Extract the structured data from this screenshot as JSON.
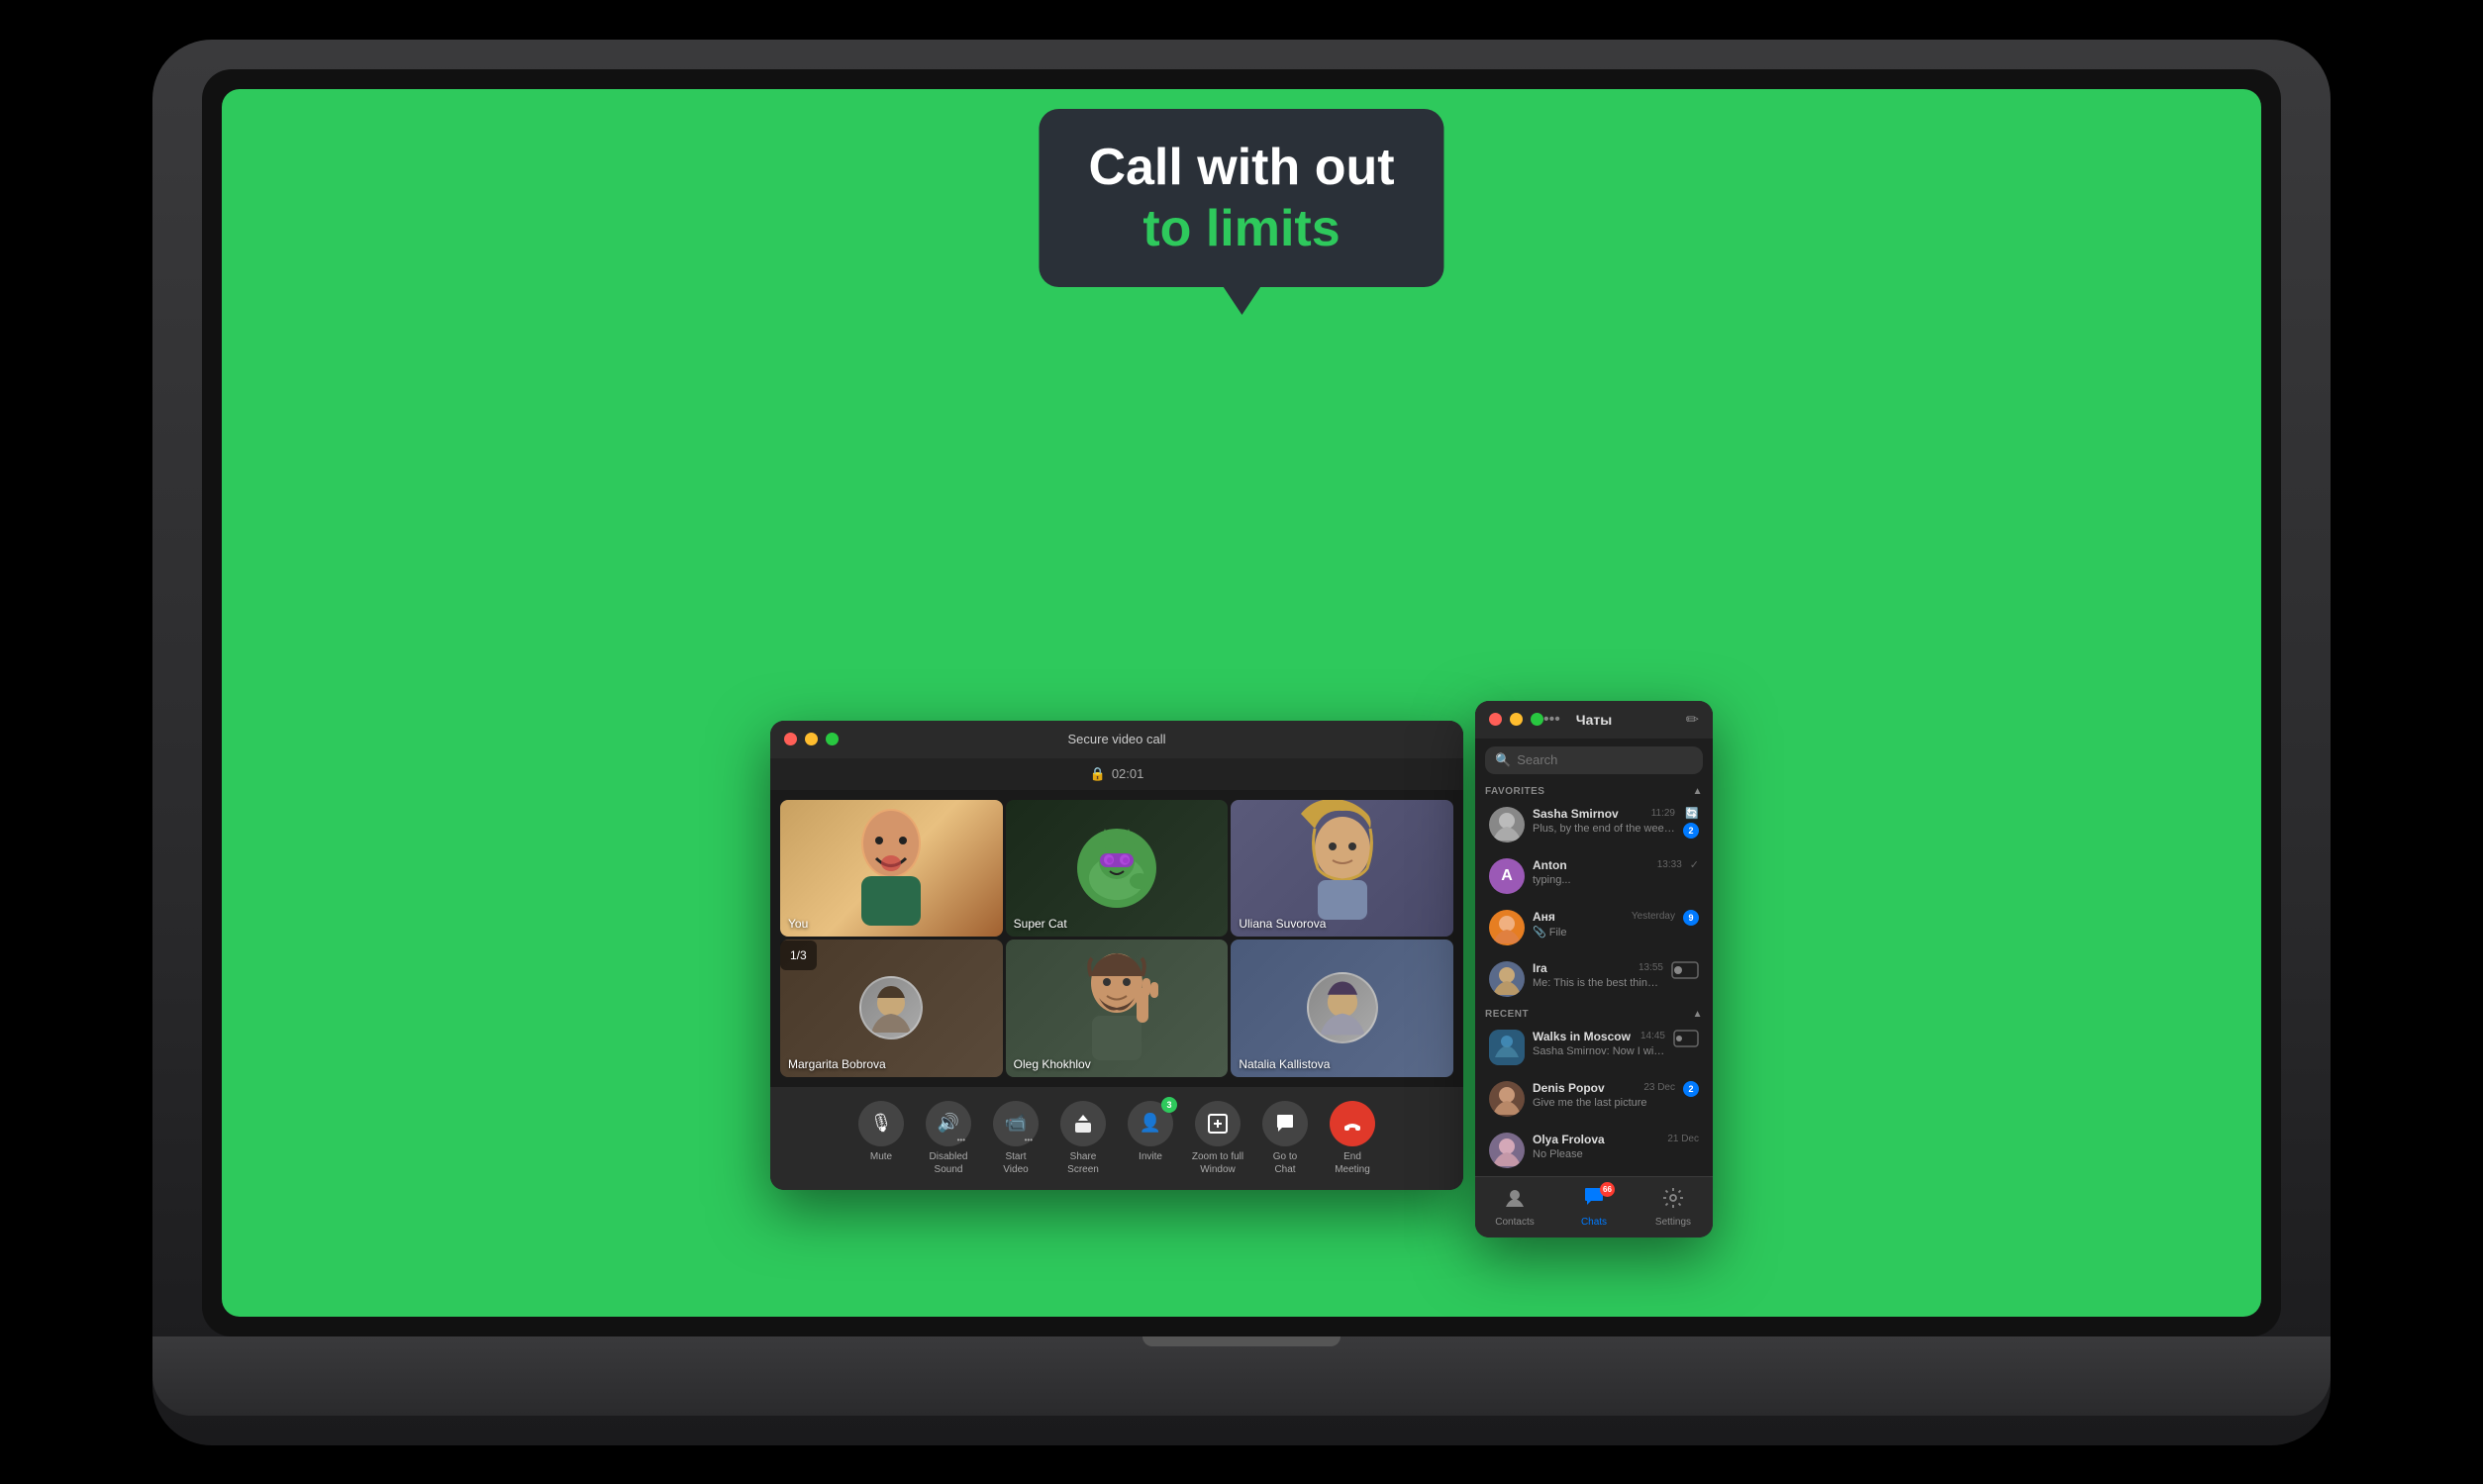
{
  "speechBubble": {
    "line1": "Call with out",
    "line2": "to limits"
  },
  "videoWindow": {
    "titlebarLabel": "Secure video call",
    "timer": "02:01",
    "participants": [
      {
        "id": "you",
        "label": "You",
        "type": "person"
      },
      {
        "id": "supercat",
        "label": "Super Cat",
        "type": "avatar"
      },
      {
        "id": "uliana",
        "label": "Uliana Suvorova",
        "type": "person"
      },
      {
        "id": "margarita",
        "label": "Margarita Bobrova",
        "type": "avatar"
      },
      {
        "id": "oleg",
        "label": "Oleg Khokhlov",
        "type": "person"
      },
      {
        "id": "natalia",
        "label": "Natalia Kallistova",
        "type": "avatar"
      }
    ],
    "pageIndicator": "1/3",
    "controls": [
      {
        "id": "mute",
        "icon": "🎙",
        "label": "Mute",
        "type": "normal"
      },
      {
        "id": "sound",
        "icon": "🔊",
        "label": "Disabled\nSound",
        "type": "normal",
        "hasDots": true
      },
      {
        "id": "video",
        "icon": "📹",
        "label": "Start\nVideo",
        "type": "normal",
        "hasDots": true
      },
      {
        "id": "share",
        "icon": "⬆",
        "label": "Share\nScreen",
        "type": "normal"
      },
      {
        "id": "invite",
        "icon": "👤",
        "label": "Invite",
        "type": "normal",
        "badge": "3"
      },
      {
        "id": "zoom",
        "icon": "⊡",
        "label": "Zoom to full\nWindow",
        "type": "normal"
      },
      {
        "id": "chat",
        "icon": "💬",
        "label": "Go to\nChat",
        "type": "normal"
      },
      {
        "id": "end",
        "icon": "📞",
        "label": "End\nMeeting",
        "type": "red"
      }
    ]
  },
  "chatWindow": {
    "title": "Чаты",
    "searchPlaceholder": "Search",
    "sections": {
      "favorites": "FAVORITES",
      "recent": "RECENT"
    },
    "favoriteChats": [
      {
        "id": "sasha",
        "name": "Sasha Smirnov",
        "time": "11:29",
        "preview": "Plus, by the end of the week we will be able to discuss what has ...",
        "avatarColor": "#888",
        "hasIcons": true
      },
      {
        "id": "anton",
        "name": "Anton",
        "time": "13:33",
        "preview": "typing...",
        "avatarColor": "#9b59b6",
        "avatarText": "A"
      },
      {
        "id": "anya",
        "name": "Аня",
        "time": "Yesterday",
        "preview": "📎 File",
        "avatarColor": "#e67e22",
        "badge": "9"
      },
      {
        "id": "ira",
        "name": "Ira",
        "time": "13:55",
        "preview": "Me: This is the best thing I've seen in a long time",
        "avatarColor": "#888"
      }
    ],
    "recentChats": [
      {
        "id": "walks",
        "name": "Walks in Moscow",
        "time": "14:45",
        "preview": "Sasha Smirnov: Now I will come to you",
        "avatarColor": "#2a4a6a"
      },
      {
        "id": "denis",
        "name": "Denis Popov",
        "time": "23 Dec",
        "preview": "Give me the last picture",
        "avatarColor": "#6a3a2a",
        "badge": "2"
      },
      {
        "id": "olya",
        "name": "Olya Frolova",
        "time": "21 Dec",
        "preview": "No Please",
        "avatarColor": "#888"
      }
    ],
    "bottomNav": [
      {
        "id": "contacts",
        "icon": "👤",
        "label": "Contacts",
        "active": false
      },
      {
        "id": "chats",
        "icon": "💬",
        "label": "Chats",
        "active": true,
        "badge": "66"
      },
      {
        "id": "settings",
        "icon": "⚙",
        "label": "Settings",
        "active": false
      }
    ]
  }
}
